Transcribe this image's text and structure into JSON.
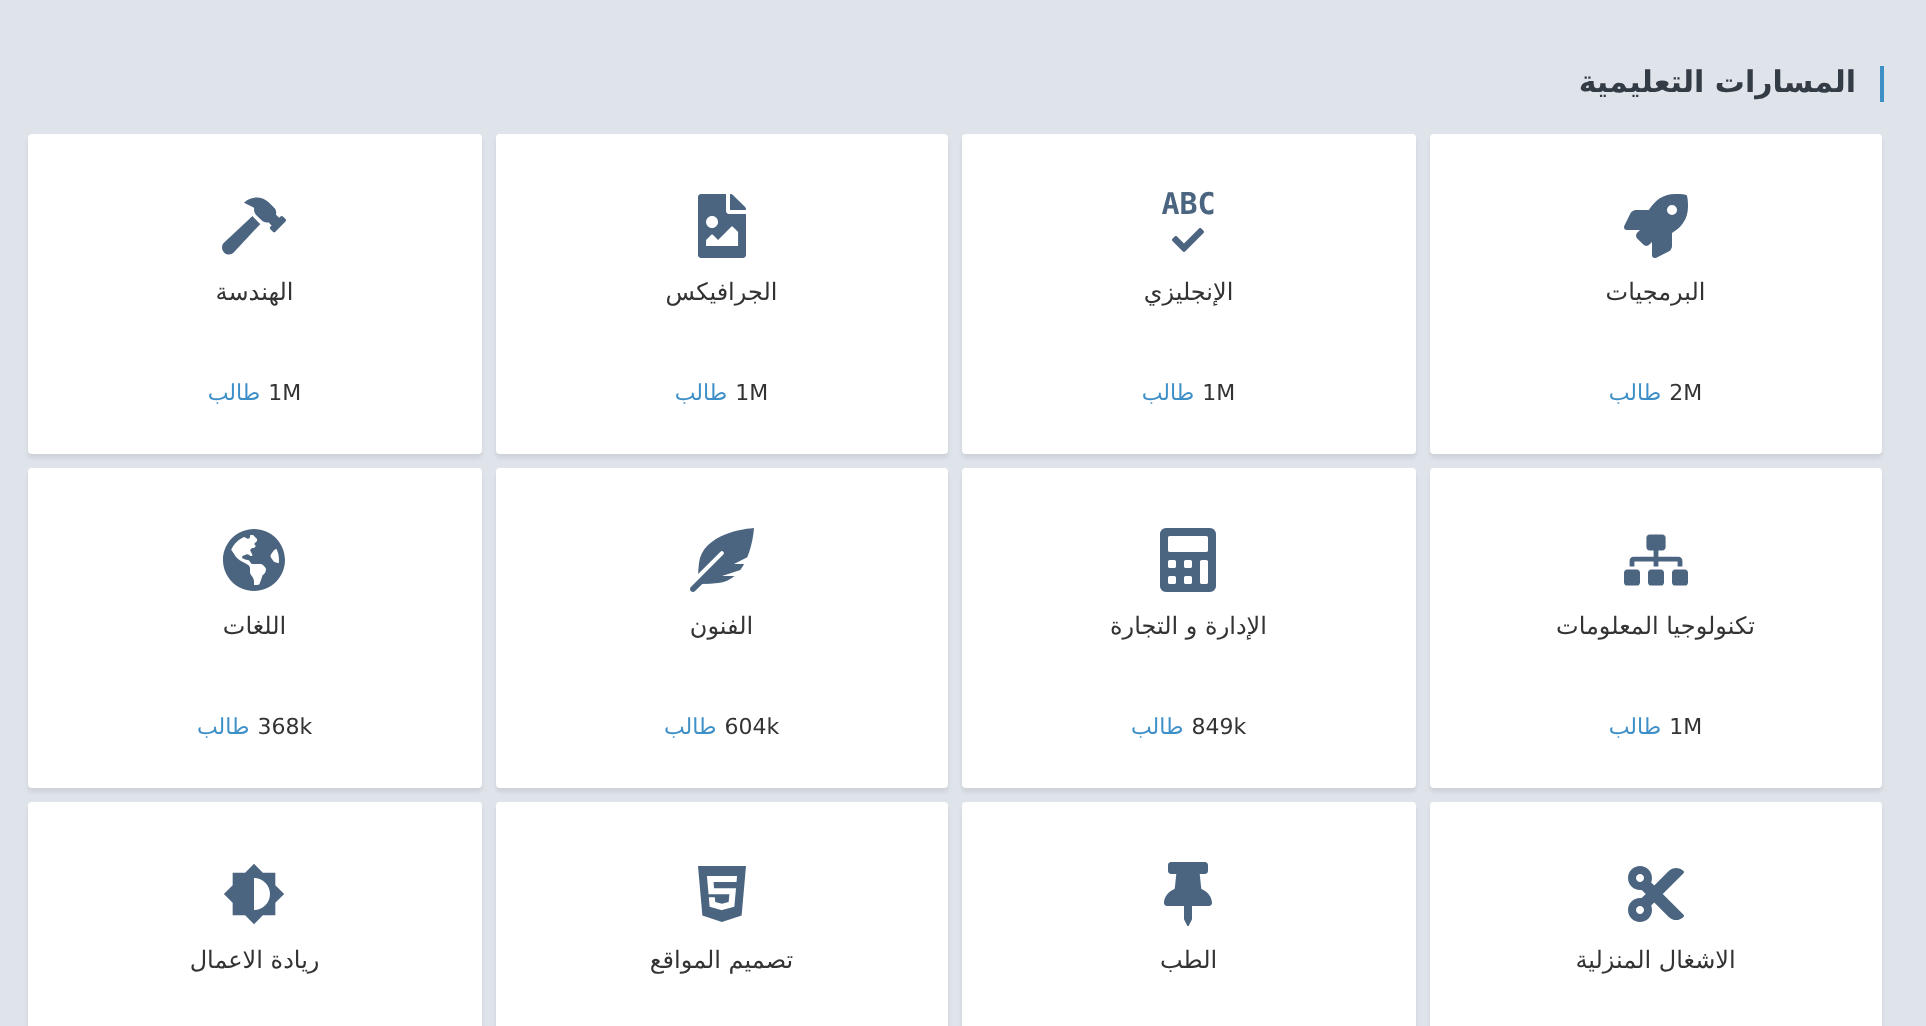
{
  "section": {
    "title": "المسارات التعليمية"
  },
  "tracks": [
    {
      "name": "البرمجيات",
      "count": "2M",
      "unit": "طالب"
    },
    {
      "name": "الإنجليزي",
      "icon_text": "ABC",
      "count": "1M",
      "unit": "طالب"
    },
    {
      "name": "الجرافيكس",
      "count": "1M",
      "unit": "طالب"
    },
    {
      "name": "الهندسة",
      "count": "1M",
      "unit": "طالب"
    },
    {
      "name": "تكنولوجيا المعلومات",
      "count": "1M",
      "unit": "طالب"
    },
    {
      "name": "الإدارة و التجارة",
      "count": "849k",
      "unit": "طالب"
    },
    {
      "name": "الفنون",
      "count": "604k",
      "unit": "طالب"
    },
    {
      "name": "اللغات",
      "count": "368k",
      "unit": "طالب"
    },
    {
      "name": "الاشغال المنزلية"
    },
    {
      "name": "الطب"
    },
    {
      "name": "تصميم المواقع"
    },
    {
      "name": "ريادة الاعمال"
    }
  ]
}
